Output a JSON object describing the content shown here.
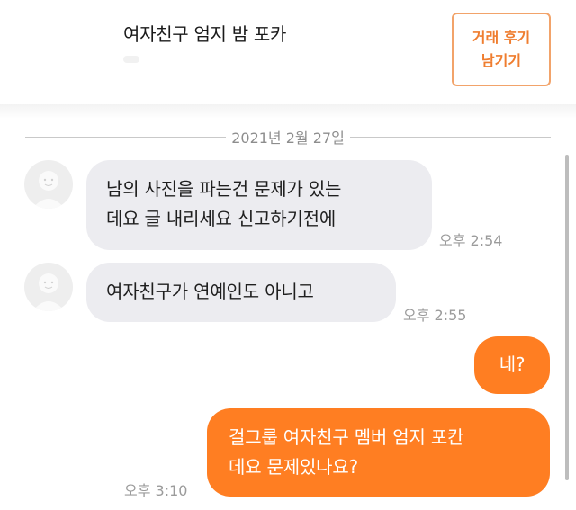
{
  "header": {
    "title": "여자친구 엄지 밤 포카",
    "review_button_line1": "거래 후기",
    "review_button_line2": "남기기"
  },
  "chat": {
    "date_separator": "2021년 2월 27일",
    "messages": [
      {
        "side": "in",
        "lines": [
          "남의 사진을 파는건 문제가 있는",
          "데요 글 내리세요 신고하기전에"
        ],
        "time": "오후 2:54"
      },
      {
        "side": "in",
        "lines": [
          "여자친구가 연예인도 아니고"
        ],
        "time": "오후 2:55"
      },
      {
        "side": "out",
        "lines": [
          "네?"
        ],
        "time": ""
      },
      {
        "side": "out",
        "lines": [
          "걸그룹 여자친구 멤버 엄지 포칸",
          "데요 문제있나요?"
        ],
        "time": "오후 3:10"
      }
    ]
  },
  "colors": {
    "accent": "#ff7e22",
    "incoming_bubble": "#ececf0",
    "review_button_border": "#f2a36a"
  },
  "icons": {
    "avatar": "default-profile-avatar-icon"
  }
}
